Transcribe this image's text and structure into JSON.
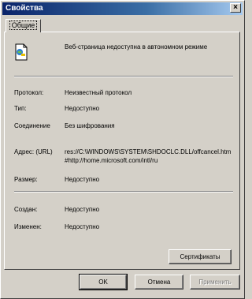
{
  "window": {
    "title": "Свойства",
    "close_label": "×"
  },
  "tabs": [
    {
      "label": "Общие"
    }
  ],
  "header": {
    "text": "Веб-страница недоступна в автономном режиме"
  },
  "properties": [
    {
      "label": "Протокол:",
      "value": "Неизвестный протокол"
    },
    {
      "label": "Тип:",
      "value": "Недоступно"
    },
    {
      "label": "Соединение",
      "value": "Без шифрования"
    },
    {
      "label": "Адрес: (URL)",
      "value": "res://C:\\WINDOWS\\SYSTEM\\SHDOCLC.DLL/offcancel.htm#http://home.microsoft.com/intl/ru"
    },
    {
      "label": "Размер:",
      "value": "Недоступно"
    },
    {
      "label": "Создан:",
      "value": "Недоступно"
    },
    {
      "label": "Изменен:",
      "value": "Недоступно"
    }
  ],
  "buttons": {
    "certificates": "Сертификаты",
    "ok": "OK",
    "cancel": "Отмена",
    "apply": "Применить"
  }
}
